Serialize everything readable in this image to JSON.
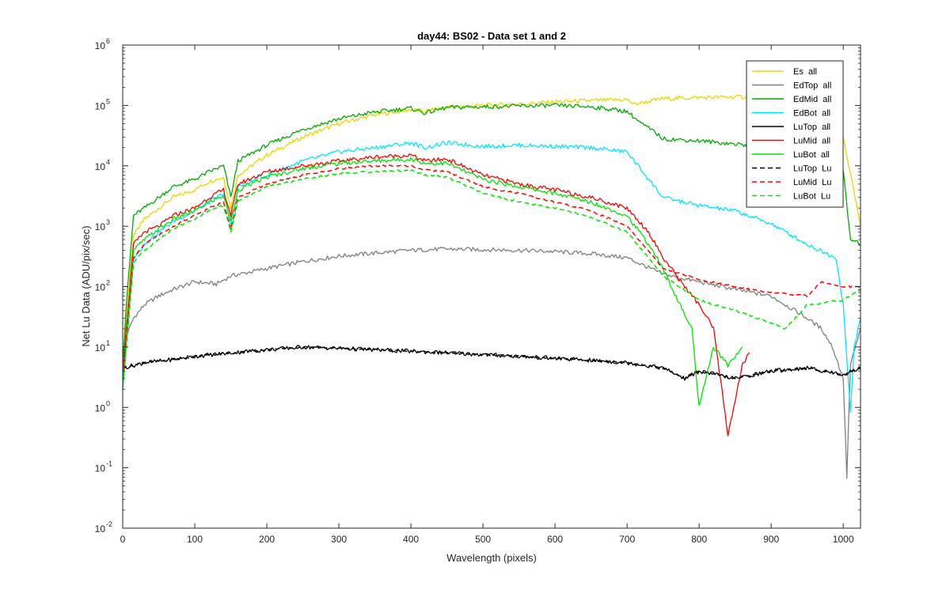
{
  "chart_data": {
    "type": "line",
    "title": "day44: BS02 - Data set 1 and 2",
    "xlabel": "Wavelength (pixels)",
    "ylabel": "Net Lu Data (ADU/pix/sec)",
    "xlim": [
      0,
      1024
    ],
    "ylim": [
      0.01,
      1000000
    ],
    "yscale": "log",
    "grid": false,
    "legend_position": "top-right",
    "x_ticks": [
      "0",
      "100",
      "200",
      "300",
      "400",
      "500",
      "600",
      "700",
      "800",
      "900",
      "1000"
    ],
    "y_ticks": [
      {
        "base": "10",
        "exp": "-2",
        "value": 0.01
      },
      {
        "base": "10",
        "exp": "-1",
        "value": 0.1
      },
      {
        "base": "10",
        "exp": "0",
        "value": 1
      },
      {
        "base": "10",
        "exp": "1",
        "value": 10
      },
      {
        "base": "10",
        "exp": "2",
        "value": 100
      },
      {
        "base": "10",
        "exp": "3",
        "value": 1000
      },
      {
        "base": "10",
        "exp": "4",
        "value": 10000
      },
      {
        "base": "10",
        "exp": "5",
        "value": 100000
      },
      {
        "base": "10",
        "exp": "6",
        "value": 1000000
      }
    ],
    "series": [
      {
        "name": "Es  all",
        "color": "#e5d800",
        "dash": "solid",
        "x": [
          0,
          5,
          15,
          30,
          50,
          70,
          100,
          120,
          140,
          150,
          160,
          200,
          250,
          300,
          350,
          400,
          420,
          450,
          500,
          550,
          600,
          650,
          700,
          710,
          750,
          800,
          850,
          900,
          950,
          1000,
          1024
        ],
        "y": [
          3,
          30,
          700,
          1300,
          2000,
          3000,
          4000,
          5500,
          6500,
          2000,
          7000,
          15000,
          30000,
          50000,
          70000,
          85000,
          80000,
          95000,
          100000,
          105000,
          115000,
          120000,
          125000,
          105000,
          130000,
          135000,
          138000,
          140000,
          130000,
          30000,
          1000
        ]
      },
      {
        "name": "EdTop  all",
        "color": "#808080",
        "dash": "solid",
        "x": [
          0,
          5,
          15,
          30,
          50,
          70,
          100,
          130,
          150,
          200,
          250,
          300,
          350,
          400,
          450,
          500,
          550,
          600,
          650,
          700,
          750,
          800,
          850,
          900,
          950,
          970,
          985,
          1000,
          1005,
          1010,
          1024
        ],
        "y": [
          8,
          15,
          30,
          50,
          70,
          90,
          120,
          110,
          150,
          200,
          260,
          320,
          360,
          400,
          420,
          410,
          400,
          380,
          350,
          300,
          160,
          120,
          90,
          70,
          30,
          20,
          10,
          3,
          0.07,
          5,
          20
        ]
      },
      {
        "name": "EdMid  all",
        "color": "#00aa00",
        "dash": "solid",
        "x": [
          0,
          5,
          15,
          30,
          50,
          70,
          100,
          120,
          140,
          150,
          160,
          200,
          250,
          300,
          350,
          400,
          420,
          450,
          500,
          550,
          600,
          650,
          700,
          720,
          740,
          750,
          800,
          850,
          900,
          950,
          1000,
          1010,
          1024
        ],
        "y": [
          5,
          50,
          1500,
          2000,
          3000,
          4500,
          6000,
          8000,
          10000,
          3000,
          12000,
          22000,
          40000,
          60000,
          78000,
          90000,
          75000,
          92000,
          95000,
          98000,
          100000,
          95000,
          80000,
          50000,
          35000,
          28000,
          26000,
          23000,
          20000,
          17000,
          8000,
          600,
          500
        ]
      },
      {
        "name": "EdBot  all",
        "color": "#00e5ff",
        "dash": "solid",
        "x": [
          0,
          5,
          15,
          30,
          50,
          70,
          100,
          120,
          140,
          150,
          160,
          200,
          250,
          300,
          350,
          400,
          420,
          450,
          500,
          550,
          600,
          650,
          700,
          730,
          750,
          800,
          850,
          900,
          950,
          990,
          1000,
          1010,
          1015,
          1024
        ],
        "y": [
          2,
          10,
          300,
          500,
          800,
          1200,
          1800,
          2500,
          3500,
          1000,
          4500,
          7000,
          12000,
          17000,
          20000,
          24000,
          20000,
          24000,
          21000,
          22000,
          21000,
          20000,
          17000,
          6000,
          3000,
          2200,
          1800,
          1100,
          500,
          300,
          50,
          0.8,
          10,
          30
        ]
      },
      {
        "name": "LuTop  all",
        "color": "#000000",
        "dash": "solid",
        "x": [
          0,
          30,
          60,
          100,
          150,
          200,
          250,
          300,
          350,
          400,
          450,
          500,
          550,
          600,
          650,
          700,
          750,
          780,
          800,
          850,
          900,
          950,
          1000,
          1024
        ],
        "y": [
          4.5,
          5.5,
          6,
          7,
          8,
          9,
          10,
          9.5,
          9,
          8.5,
          8,
          7.5,
          7,
          6.5,
          6,
          5.5,
          4.5,
          3,
          4,
          3,
          4,
          4.5,
          3.5,
          4.5
        ]
      },
      {
        "name": "LuMid  all",
        "color": "#ff0000",
        "dash": "solid",
        "x": [
          0,
          5,
          15,
          30,
          50,
          70,
          100,
          120,
          140,
          150,
          160,
          200,
          250,
          300,
          350,
          400,
          420,
          450,
          500,
          550,
          600,
          650,
          700,
          730,
          750,
          780,
          800,
          820,
          840,
          860,
          870
        ],
        "y": [
          3,
          20,
          500,
          800,
          1000,
          1500,
          2000,
          3000,
          4000,
          1500,
          5000,
          8000,
          10000,
          12000,
          14000,
          15000,
          12000,
          13000,
          7000,
          5000,
          4000,
          3000,
          2000,
          800,
          300,
          100,
          50,
          20,
          0.35,
          5,
          8
        ]
      },
      {
        "name": "LuBot  all",
        "color": "#00e600",
        "dash": "solid",
        "x": [
          0,
          5,
          15,
          30,
          50,
          70,
          100,
          120,
          140,
          150,
          160,
          200,
          250,
          300,
          350,
          400,
          420,
          450,
          500,
          550,
          600,
          650,
          700,
          730,
          750,
          770,
          790,
          800,
          820,
          840,
          860
        ],
        "y": [
          2,
          15,
          400,
          600,
          900,
          1300,
          1800,
          2500,
          3200,
          1200,
          4000,
          6500,
          9000,
          11000,
          12000,
          13000,
          11000,
          11000,
          6000,
          4500,
          3500,
          2500,
          1500,
          500,
          200,
          60,
          20,
          1,
          10,
          5,
          10
        ]
      },
      {
        "name": "LuTop  Lu",
        "color": "#000000",
        "dash": "dashed",
        "x": [
          0,
          30,
          60,
          100,
          150,
          200,
          250,
          300,
          350,
          400,
          450,
          500,
          550,
          600,
          650,
          700,
          750,
          780,
          800,
          850,
          900,
          950,
          1000,
          1024
        ],
        "y": [
          4.5,
          5.5,
          6,
          7,
          8,
          9,
          10,
          9.5,
          9,
          8.5,
          8,
          7.5,
          7,
          6.5,
          6,
          5.5,
          4.5,
          3,
          4,
          3,
          4,
          4.5,
          3.5,
          4.5
        ]
      },
      {
        "name": "LuMid  Lu",
        "color": "#ff0000",
        "dash": "dashed",
        "x": [
          0,
          5,
          15,
          30,
          50,
          70,
          100,
          120,
          140,
          150,
          160,
          200,
          250,
          300,
          350,
          400,
          420,
          450,
          500,
          550,
          600,
          650,
          700,
          750,
          800,
          850,
          900,
          950,
          970,
          1000,
          1024
        ],
        "y": [
          3,
          15,
          300,
          500,
          700,
          1000,
          1500,
          2000,
          2500,
          900,
          3000,
          5000,
          7000,
          9000,
          10000,
          10000,
          8500,
          8000,
          4500,
          3500,
          2500,
          1800,
          1000,
          200,
          130,
          100,
          80,
          70,
          120,
          100,
          100
        ]
      },
      {
        "name": "LuBot  Lu",
        "color": "#00e600",
        "dash": "dashed",
        "x": [
          0,
          5,
          15,
          30,
          50,
          70,
          100,
          120,
          140,
          150,
          160,
          200,
          250,
          300,
          350,
          400,
          420,
          450,
          500,
          550,
          600,
          650,
          700,
          750,
          800,
          850,
          900,
          920,
          950,
          1000,
          1024
        ],
        "y": [
          2,
          10,
          250,
          400,
          600,
          900,
          1300,
          1800,
          2200,
          800,
          2600,
          4500,
          6000,
          7500,
          8000,
          8500,
          7000,
          6500,
          3500,
          2500,
          2000,
          1400,
          800,
          150,
          60,
          40,
          25,
          20,
          50,
          60,
          90
        ]
      }
    ]
  }
}
